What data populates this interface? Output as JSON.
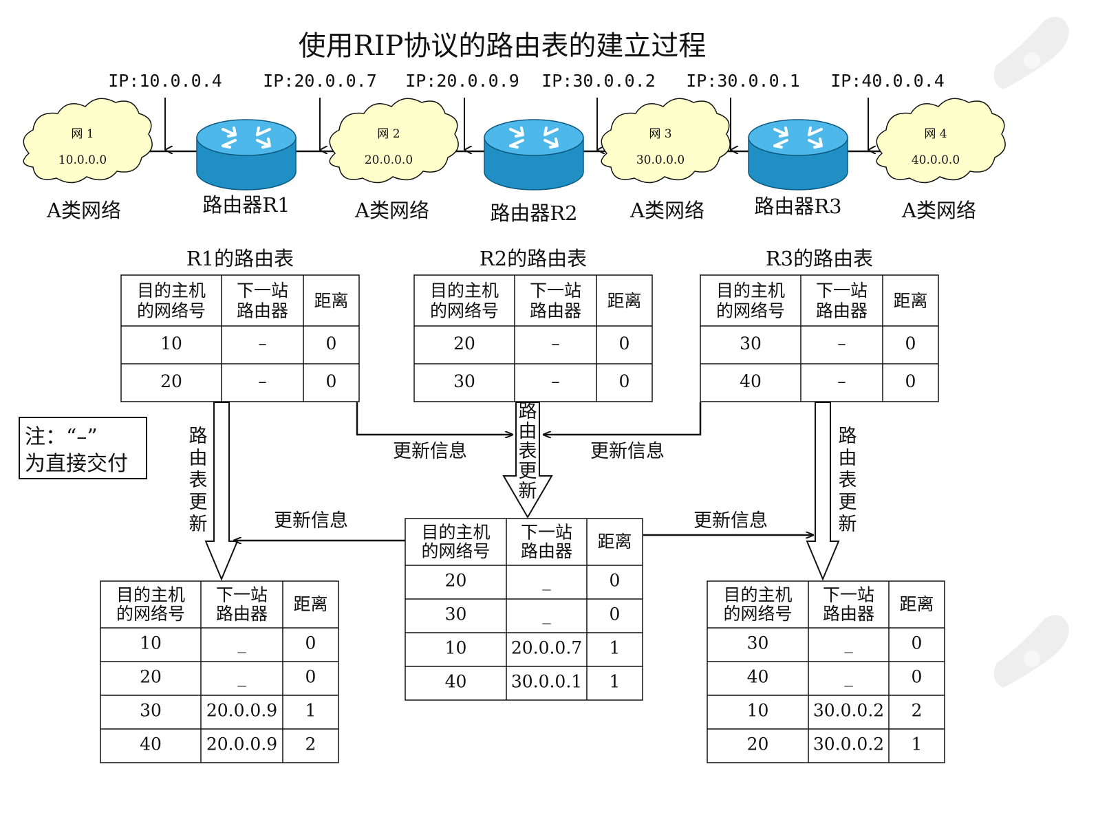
{
  "title": "使用RIP协议的路由表的建立过程",
  "ips": [
    "IP:10.0.0.4",
    "IP:20.0.0.7",
    "IP:20.0.0.9",
    "IP:30.0.0.2",
    "IP:30.0.0.1",
    "IP:40.0.0.4"
  ],
  "networks": [
    {
      "name": "网 1",
      "addr": "10.0.0.0",
      "type": "A类网络"
    },
    {
      "name": "网 2",
      "addr": "20.0.0.0",
      "type": "A类网络"
    },
    {
      "name": "网 3",
      "addr": "30.0.0.0",
      "type": "A类网络"
    },
    {
      "name": "网 4",
      "addr": "40.0.0.0",
      "type": "A类网络"
    }
  ],
  "routers": [
    "路由器R1",
    "路由器R2",
    "路由器R3"
  ],
  "headers": {
    "dest": [
      "目的主机",
      "的网络号"
    ],
    "next": [
      "下一站",
      "路由器"
    ],
    "dist": "距离"
  },
  "tables": [
    {
      "title": "R1的路由表",
      "rows": [
        [
          "10",
          "–",
          "0"
        ],
        [
          "20",
          "–",
          "0"
        ]
      ]
    },
    {
      "title": "R2的路由表",
      "rows": [
        [
          "20",
          "–",
          "0"
        ],
        [
          "30",
          "–",
          "0"
        ]
      ]
    },
    {
      "title": "R3的路由表",
      "rows": [
        [
          "30",
          "–",
          "0"
        ],
        [
          "40",
          "–",
          "0"
        ]
      ]
    },
    {
      "title": "",
      "rows": [
        [
          "10",
          "_",
          "0"
        ],
        [
          "20",
          "_",
          "0"
        ],
        [
          "30",
          "20.0.0.9",
          "1"
        ],
        [
          "40",
          "20.0.0.9",
          "2"
        ]
      ]
    },
    {
      "title": "",
      "rows": [
        [
          "20",
          "_",
          "0"
        ],
        [
          "30",
          "_",
          "0"
        ],
        [
          "10",
          "20.0.0.7",
          "1"
        ],
        [
          "40",
          "30.0.0.1",
          "1"
        ]
      ]
    },
    {
      "title": "",
      "rows": [
        [
          "30",
          "_",
          "0"
        ],
        [
          "40",
          "_",
          "0"
        ],
        [
          "10",
          "30.0.0.2",
          "2"
        ],
        [
          "20",
          "30.0.0.2",
          "1"
        ]
      ]
    }
  ],
  "note": [
    "注：“–”",
    "为直接交付"
  ],
  "update_info": "更新信息",
  "route_update": "路由表更新",
  "colors": {
    "cloud_fill": "#ffffcc",
    "router_top": "#4fb8ea",
    "router_side": "#1f8fc4",
    "line": "#111111"
  }
}
